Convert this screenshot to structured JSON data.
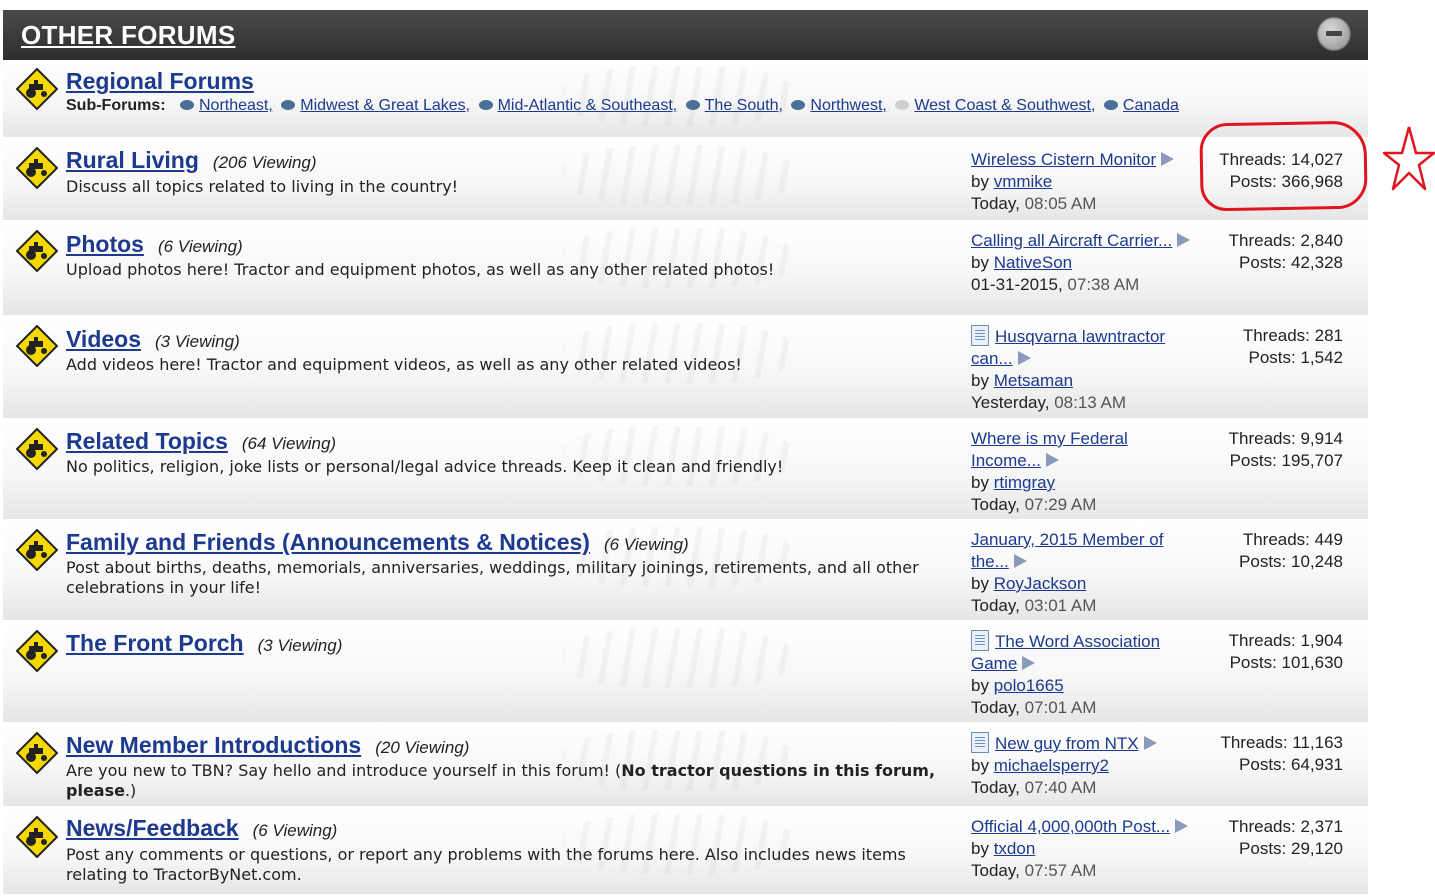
{
  "section": {
    "title": "OTHER FORUMS"
  },
  "regional": {
    "name": "Regional Forums",
    "subforums_label": "Sub-Forums:",
    "subforums": [
      "Northeast,",
      "Midwest & Great Lakes,",
      "Mid-Atlantic & Southeast,",
      "The South,",
      "Northwest,",
      "West Coast & Southwest,",
      "Canada"
    ]
  },
  "forums": [
    {
      "name": "Rural Living",
      "viewing": "(206 Viewing)",
      "desc": "Discuss all topics related to living in the country!",
      "last_title": "Wireless Cistern Monitor",
      "by": "by",
      "last_user": "vmmike",
      "last_day": "Today,",
      "last_time": "08:05 AM",
      "threads": "Threads: 14,027",
      "posts": "Posts: 366,968"
    },
    {
      "name": "Photos",
      "viewing": "(6 Viewing)",
      "desc": "Upload photos here! Tractor and equipment photos, as well as any other related photos!",
      "last_title": "Calling all Aircraft Carrier...",
      "by": "by",
      "last_user": "NativeSon",
      "last_day": "01-31-2015,",
      "last_time": "07:38 AM",
      "threads": "Threads: 2,840",
      "posts": "Posts: 42,328"
    },
    {
      "name": "Videos",
      "viewing": "(3 Viewing)",
      "desc": "Add videos here! Tractor and equipment videos, as well as any other related videos!",
      "last_title": "Husqvarna lawntractor can...",
      "by": "by",
      "last_user": "Metsaman",
      "last_day": "Yesterday,",
      "last_time": "08:13 AM",
      "threads": "Threads: 281",
      "posts": "Posts: 1,542"
    },
    {
      "name": "Related Topics",
      "viewing": "(64 Viewing)",
      "desc": "No politics, religion, joke lists or personal/legal advice threads. Keep it clean and friendly!",
      "last_title": "Where is my Federal Income...",
      "by": "by",
      "last_user": "rtimgray",
      "last_day": "Today,",
      "last_time": "07:29 AM",
      "threads": "Threads: 9,914",
      "posts": "Posts: 195,707"
    },
    {
      "name": "Family and Friends (Announcements & Notices)",
      "viewing": "(6 Viewing)",
      "desc": "Post about births, deaths, memorials, anniversaries, weddings, military joinings, retirements, and all other celebrations in your life!",
      "last_title": "January, 2015 Member of the...",
      "by": "by",
      "last_user": "RoyJackson",
      "last_day": "Today,",
      "last_time": "03:01 AM",
      "threads": "Threads: 449",
      "posts": "Posts: 10,248"
    },
    {
      "name": "The Front Porch",
      "viewing": "(3 Viewing)",
      "desc": "",
      "last_title": "The Word Association Game",
      "by": "by",
      "last_user": "polo1665",
      "last_day": "Today,",
      "last_time": "07:01 AM",
      "threads": "Threads: 1,904",
      "posts": "Posts: 101,630"
    },
    {
      "name": "New Member Introductions",
      "viewing": "(20 Viewing)",
      "desc": "Are you new to TBN? Say hello and introduce yourself in this forum! (",
      "desc_bold": "No tractor questions in this forum, please",
      "desc_end": ".)",
      "last_title": "New guy from NTX",
      "by": "by",
      "last_user": "michaelsperry2",
      "last_day": "Today,",
      "last_time": "07:40 AM",
      "threads": "Threads: 11,163",
      "posts": "Posts: 64,931"
    },
    {
      "name": "News/Feedback",
      "viewing": "(6 Viewing)",
      "desc": "Post any comments or questions, or report any problems with the forums here. Also includes news items relating to TractorByNet.com.",
      "last_title": "Official 4,000,000th Post...",
      "by": "by",
      "last_user": "txdon",
      "last_day": "Today,",
      "last_time": "07:57 AM",
      "threads": "Threads: 2,371",
      "posts": "Posts: 29,120"
    }
  ],
  "colors": {
    "link": "#1c3a8e",
    "header_bg": "#3a3a3a",
    "annotation": "#e0141e",
    "icon_yellow": "#f5d800"
  },
  "icons": {
    "forum": "tractor-sign-icon",
    "subforum": "speech-bubble-icon",
    "go_last": "arrow-right-icon",
    "post": "document-icon"
  }
}
